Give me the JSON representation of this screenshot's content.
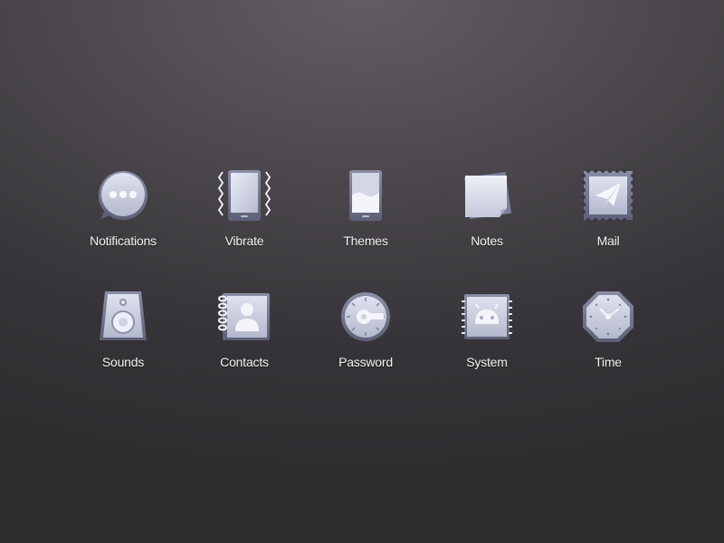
{
  "colors": {
    "icon_light": "#e6e8f2",
    "icon_mid": "#b9bdd0",
    "icon_dark": "#6d7188",
    "label_text": "#f2f2f4"
  },
  "icons": [
    {
      "label": "Notifications",
      "icon": "chat-bubble-icon"
    },
    {
      "label": "Vibrate",
      "icon": "vibrating-phone-icon"
    },
    {
      "label": "Themes",
      "icon": "phone-theme-icon"
    },
    {
      "label": "Notes",
      "icon": "sticky-note-icon"
    },
    {
      "label": "Mail",
      "icon": "stamp-paper-plane-icon"
    },
    {
      "label": "Sounds",
      "icon": "speaker-icon"
    },
    {
      "label": "Contacts",
      "icon": "address-book-icon"
    },
    {
      "label": "Password",
      "icon": "dial-lock-icon"
    },
    {
      "label": "System",
      "icon": "android-chip-icon"
    },
    {
      "label": "Time",
      "icon": "octagon-clock-icon"
    }
  ]
}
